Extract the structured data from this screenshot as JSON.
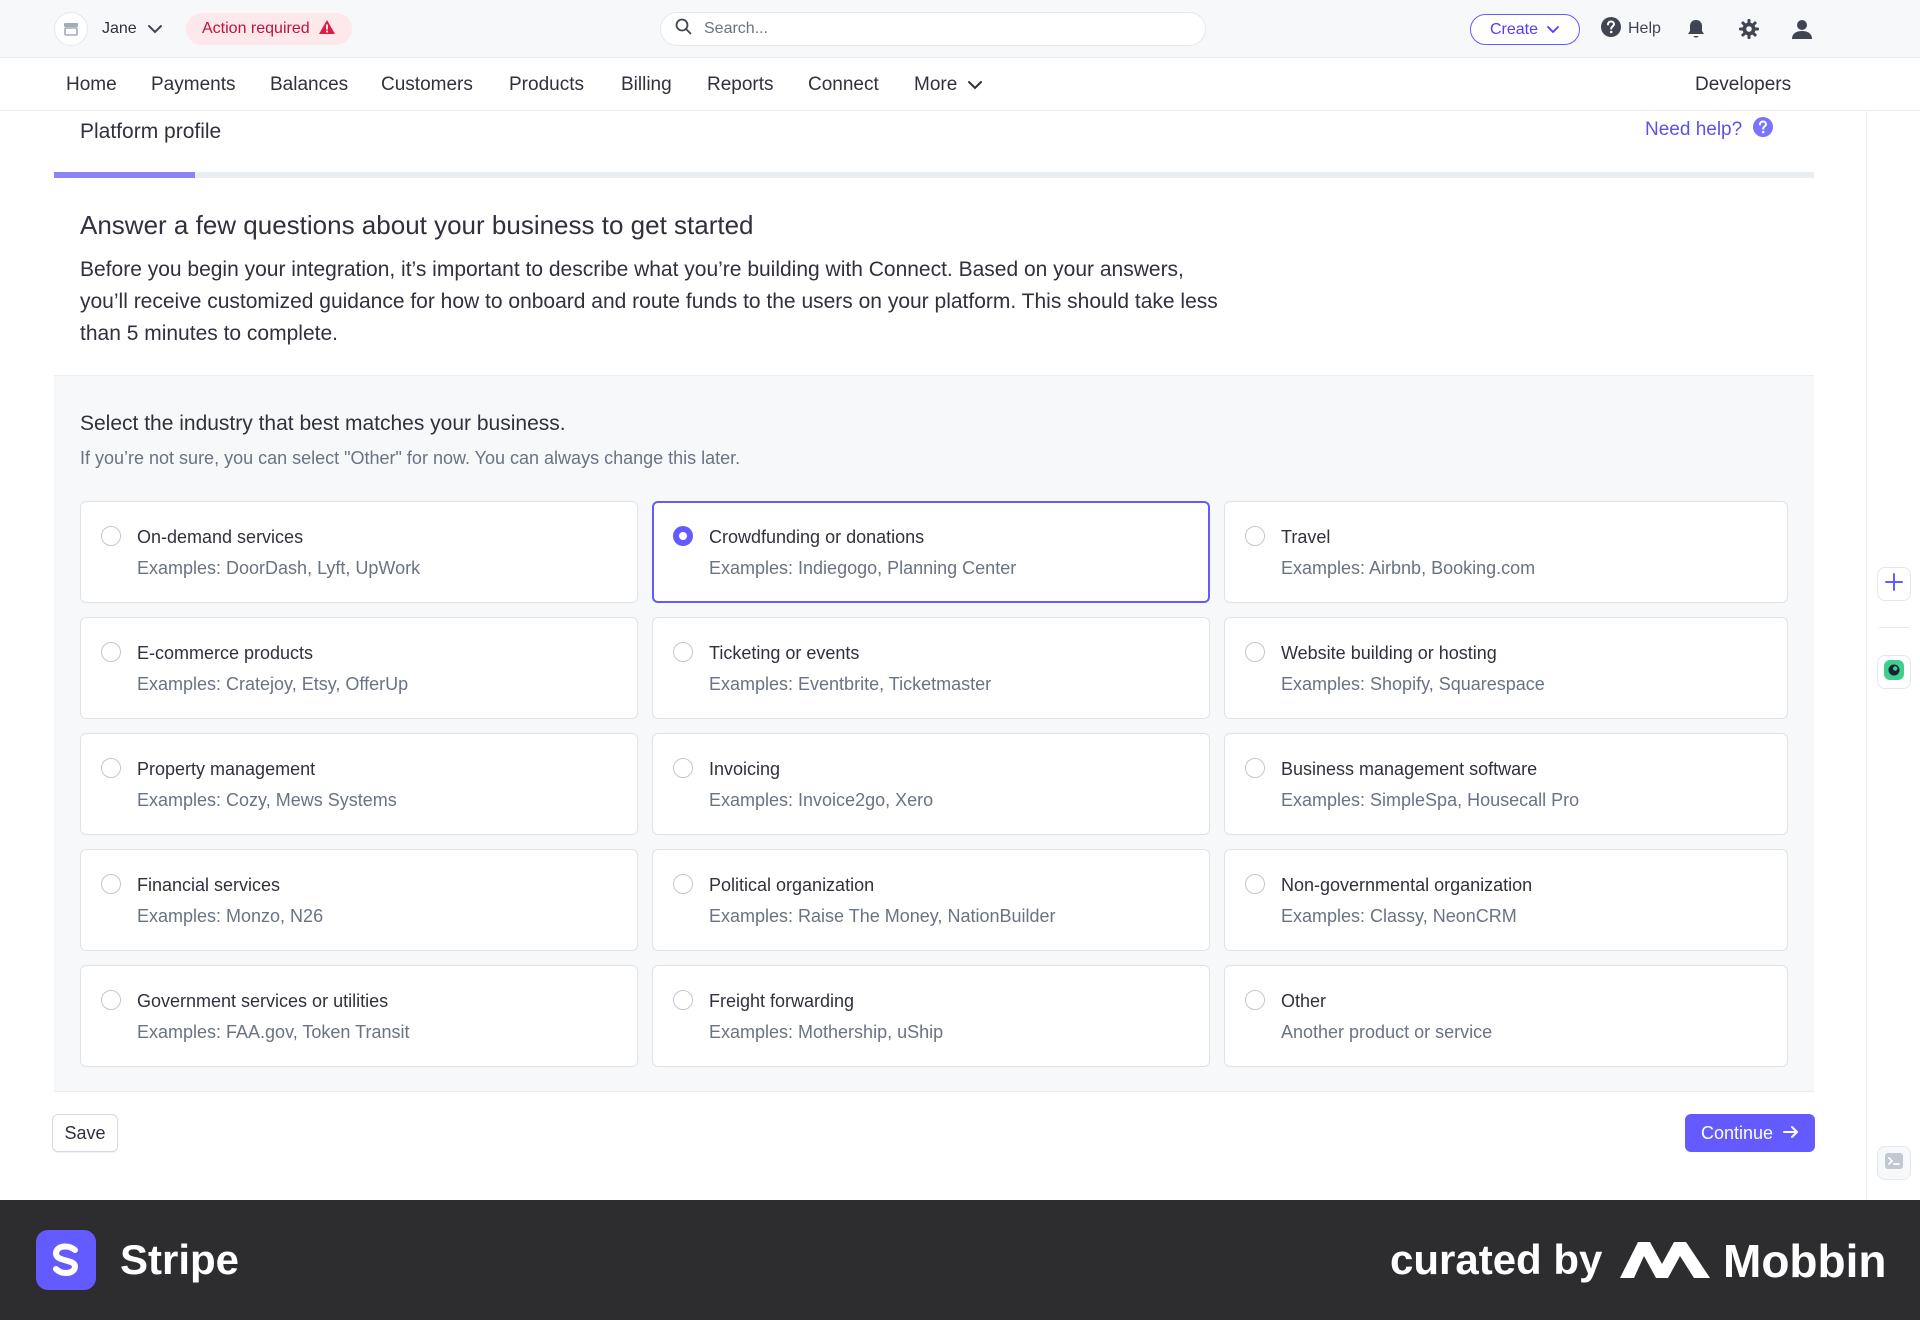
{
  "topbar": {
    "account_name": "Jane",
    "action_required": "Action required",
    "search_placeholder": "Search...",
    "create_label": "Create",
    "help_label": "Help"
  },
  "nav": {
    "items": [
      "Home",
      "Payments",
      "Balances",
      "Customers",
      "Products",
      "Billing",
      "Reports",
      "Connect",
      "More"
    ],
    "developers": "Developers"
  },
  "page": {
    "title": "Platform profile",
    "need_help": "Need help?",
    "progress": 0.08
  },
  "intro": {
    "title": "Answer a few questions about your business to get started",
    "body": "Before you begin your integration, it’s important to describe what you’re building with Connect. Based on your answers, you’ll receive customized guidance for how to onboard and route funds to the users on your platform. This should take less than 5 minutes to complete."
  },
  "question": {
    "title": "Select the industry that best matches your business.",
    "hint": "If you’re not sure, you can select \"Other\" for now. You can always change this later."
  },
  "options": [
    {
      "title": "On-demand services",
      "subtitle": "Examples: DoorDash, Lyft, UpWork"
    },
    {
      "title": "Crowdfunding or donations",
      "subtitle": "Examples: Indiegogo, Planning Center"
    },
    {
      "title": "Travel",
      "subtitle": "Examples: Airbnb, Booking.com"
    },
    {
      "title": "E-commerce products",
      "subtitle": "Examples: Cratejoy, Etsy, OfferUp"
    },
    {
      "title": "Ticketing or events",
      "subtitle": "Examples: Eventbrite, Ticketmaster"
    },
    {
      "title": "Website building or hosting",
      "subtitle": "Examples: Shopify, Squarespace"
    },
    {
      "title": "Property management",
      "subtitle": "Examples: Cozy, Mews Systems"
    },
    {
      "title": "Invoicing",
      "subtitle": "Examples: Invoice2go, Xero"
    },
    {
      "title": "Business management software",
      "subtitle": "Examples: SimpleSpa, Housecall Pro"
    },
    {
      "title": "Financial services",
      "subtitle": "Examples: Monzo, N26"
    },
    {
      "title": "Political organization",
      "subtitle": "Examples: Raise The Money, NationBuilder"
    },
    {
      "title": "Non-governmental organization",
      "subtitle": "Examples: Classy, NeonCRM"
    },
    {
      "title": "Government services or utilities",
      "subtitle": "Examples: FAA.gov, Token Transit"
    },
    {
      "title": "Freight forwarding",
      "subtitle": "Examples: Mothership, uShip"
    },
    {
      "title": "Other",
      "subtitle": "Another product or service"
    }
  ],
  "selected_option": "Crowdfunding or donations",
  "actions": {
    "save": "Save",
    "continue": "Continue"
  },
  "footer": {
    "brand": "Stripe",
    "curated_by": "curated by",
    "curator": "Mobbin"
  },
  "colors": {
    "accent": "#635bff",
    "alert_bg": "#fde8ec",
    "alert_text": "#c0123c",
    "footer_bg": "#2d2d2f"
  },
  "icons": {
    "account": "store-icon",
    "alert": "warning-triangle-icon",
    "search": "search-icon",
    "help": "question-circle-icon",
    "notifications": "bell-icon",
    "settings": "gear-icon",
    "profile": "user-icon",
    "continue": "arrow-right-icon"
  }
}
